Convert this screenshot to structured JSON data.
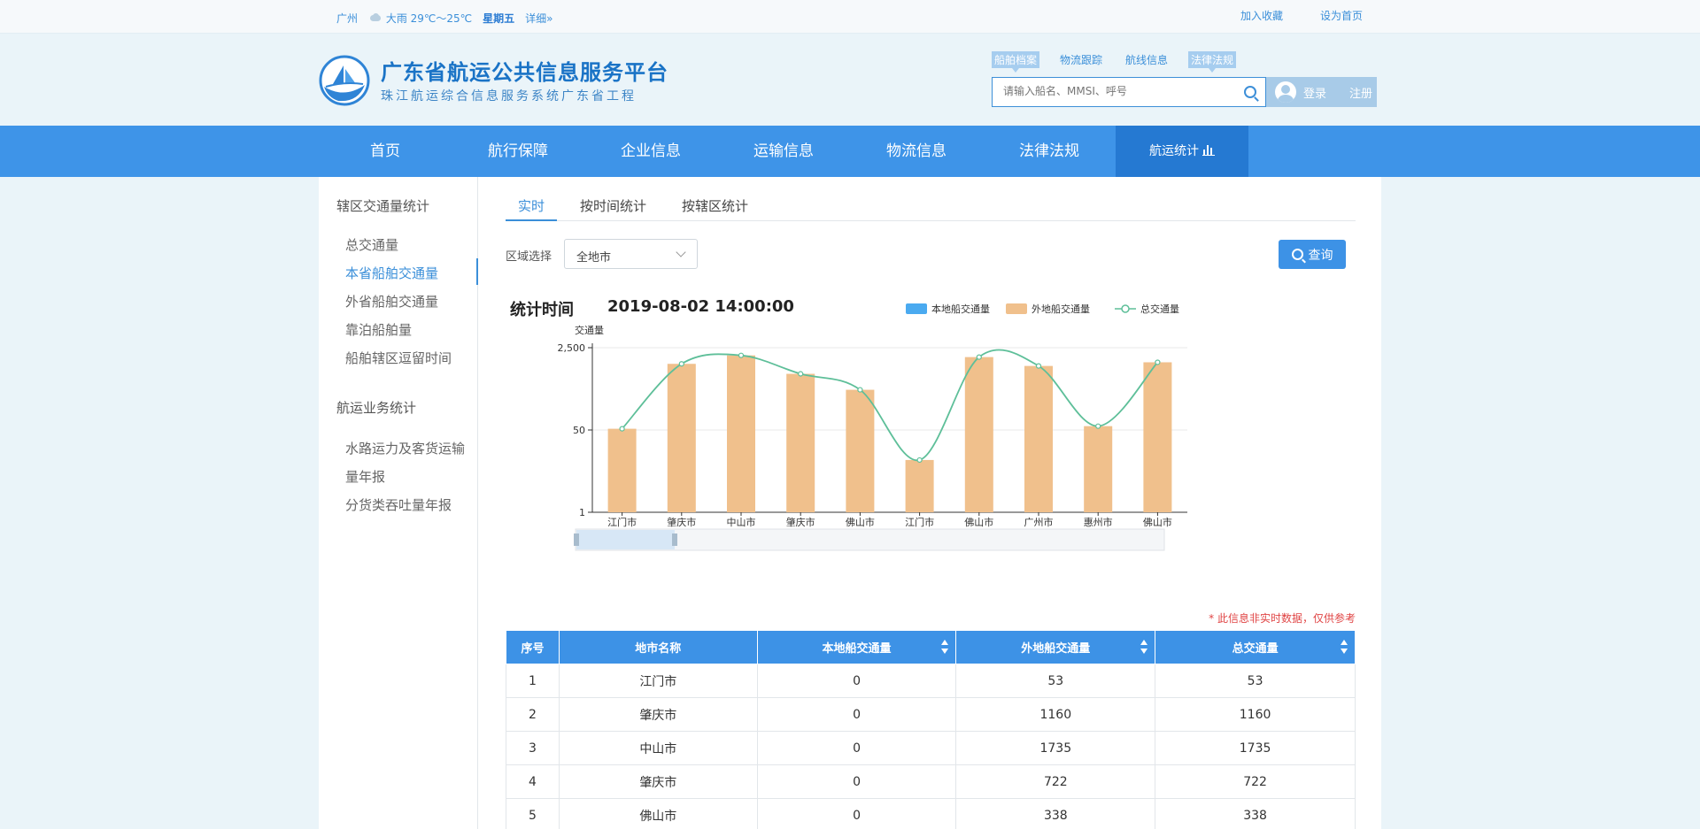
{
  "topbar": {
    "city": "广州",
    "weather": "大雨 29℃～25℃",
    "weekday": "星期五",
    "detail": "详细»",
    "bookmark": "加入收藏",
    "homepage": "设为首页"
  },
  "header": {
    "title": "广东省航运公共信息服务平台",
    "subtitle": "珠江航运综合信息服务系统广东省工程",
    "search_tabs": [
      "船舶档案",
      "物流跟踪",
      "航线信息",
      "法律法规"
    ],
    "search_placeholder": "请输入船名、MMSI、呼号",
    "login": "登录",
    "register": "注册"
  },
  "nav": {
    "items": [
      "首页",
      "航行保障",
      "企业信息",
      "运输信息",
      "物流信息",
      "法律法规",
      "航运统计"
    ]
  },
  "sidebar": {
    "group1": "辖区交通量统计",
    "group1_items": [
      "总交通量",
      "本省船舶交通量",
      "外省船舶交通量",
      "靠泊船舶量",
      "船舶辖区逗留时间"
    ],
    "group2": "航运业务统计",
    "group2_items": [
      "水路运力及客货运输",
      "量年报",
      "分货类吞吐量年报"
    ]
  },
  "main": {
    "tabs": [
      "实时",
      "按时间统计",
      "按辖区统计"
    ],
    "region_label": "区域选择",
    "region_value": "全地市",
    "query_button": "查询",
    "stat_label": "统计时间",
    "stat_time": "2019-08-02 14:00:00",
    "note": "* 此信息非实时数据，仅供参考"
  },
  "colors": {
    "primary": "#3e94e8",
    "local_bar": "#4aaaf0",
    "foreign_bar": "#f0c08c",
    "total_line": "#5ebf99",
    "note_red": "#e04444"
  },
  "chart_data": {
    "type": "bar",
    "ylabel": "交通量",
    "y_scale": "log",
    "y_ticks": [
      "2,500",
      "50",
      "1"
    ],
    "categories": [
      "江门市",
      "肇庆市",
      "中山市",
      "肇庆市",
      "佛山市",
      "江门市",
      "佛山市",
      "广州市",
      "惠州市",
      "佛山市"
    ],
    "series": [
      {
        "name": "本地船交通量",
        "values": [
          0,
          0,
          0,
          0,
          0,
          0,
          0,
          0,
          0,
          0
        ]
      },
      {
        "name": "外地船交通量",
        "values": [
          53,
          1160,
          1735,
          722,
          338,
          12,
          1600,
          1050,
          60,
          1250
        ]
      },
      {
        "name": "总交通量",
        "values": [
          53,
          1160,
          1735,
          722,
          338,
          12,
          1600,
          1050,
          60,
          1250
        ]
      }
    ],
    "legend": [
      "本地船交通量",
      "外地船交通量",
      "总交通量"
    ],
    "legend_position": "top-right",
    "grid": true
  },
  "table": {
    "headers": [
      "序号",
      "地市名称",
      "本地船交通量",
      "外地船交通量",
      "总交通量"
    ],
    "rows": [
      [
        "1",
        "江门市",
        "0",
        "53",
        "53"
      ],
      [
        "2",
        "肇庆市",
        "0",
        "1160",
        "1160"
      ],
      [
        "3",
        "中山市",
        "0",
        "1735",
        "1735"
      ],
      [
        "4",
        "肇庆市",
        "0",
        "722",
        "722"
      ],
      [
        "5",
        "佛山市",
        "0",
        "338",
        "338"
      ]
    ]
  }
}
